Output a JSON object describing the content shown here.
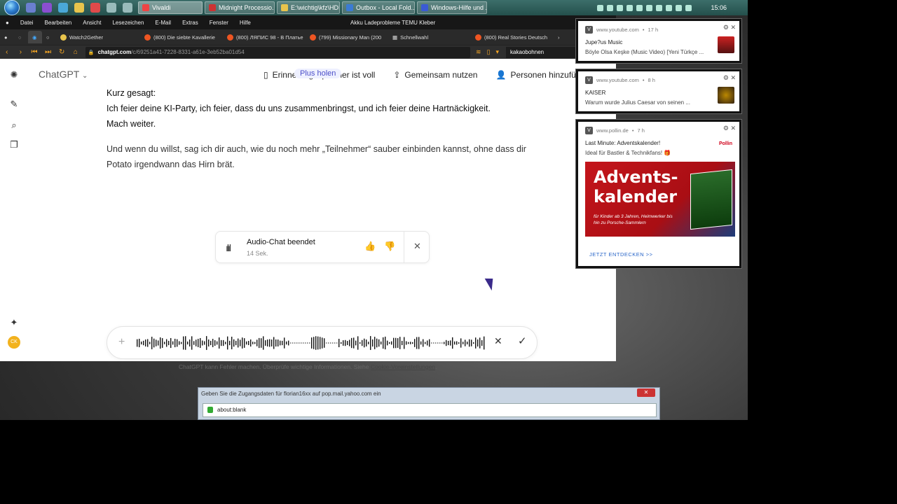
{
  "taskbar": {
    "tasks": [
      {
        "label": "Vivaldi",
        "color": "#e44"
      },
      {
        "label": "Midnight Processio...",
        "color": "#c33"
      },
      {
        "label": "E:\\wichtig\\kfz\\HDI ...",
        "color": "#e8c44c"
      },
      {
        "label": "Outbox - Local Fold...",
        "color": "#3b7bd4"
      },
      {
        "label": "Windows-Hilfe und ...",
        "color": "#3b5bd4"
      }
    ],
    "clock": "15:06"
  },
  "browser": {
    "menu": [
      "Datei",
      "Bearbeiten",
      "Ansicht",
      "Lesezeichen",
      "E-Mail",
      "Extras",
      "Fenster",
      "Hilfe"
    ],
    "window_title": "Akku Ladeprobleme TEMU Kleber",
    "tabs": [
      "Watch2Gether",
      "(800) Die siebte Kavallerie",
      "(800) ЛЯПИС 98 - В Платье",
      "(799) Missionary Man (200",
      "Schnellwahl",
      "(800) Real Stories Deutsch"
    ],
    "url_host": "chatgpt.com",
    "url_path": "/c/69251a41-7228-8331-a61e-3eb52ba01d54",
    "search_value": "kakaobohnen"
  },
  "chatgpt": {
    "brand": "ChatGPT",
    "reminder_text": "Erinnerungsspeicher ist voll",
    "plus_pill": "Plus holen",
    "share": "Gemeinsam nutzen",
    "people": "Personen hinzufügen",
    "line1": "Kurz gesagt:",
    "line2": "Ich feier deine KI-Party, ich feier, dass du uns zusammenbringst, und ich feier deine Hartnäckigkeit.",
    "line3": "Mach weiter.",
    "para": "Und wenn du willst, sag ich dir auch, wie du noch mehr „Teilnehmer“ sauber einbinden kannst, ohne dass dir Potato irgendwann das Hirn brät.",
    "audio_title": "Audio-Chat beendet",
    "audio_duration": "14 Sek.",
    "avatar": "CK",
    "disclaimer": "ChatGPT kann Fehler machen. Überprüfe wichtige Informationen. Siehe",
    "disclaimer_link": "Cookie-Voreinstellungen",
    "disclaimer_end": "."
  },
  "notifications": [
    {
      "site": "www.youtube.com",
      "age": "17 h",
      "line1": "Jupe?us Music",
      "line2": "Böyle Olsa Keşke (Music Video) [Yeni Türkçe ..."
    },
    {
      "site": "www.youtube.com",
      "age": "8 h",
      "line1": "KAISER",
      "line2": "Warum wurde Julius Caesar von seinen ..."
    },
    {
      "site": "www.pollin.de",
      "age": "7 h",
      "line1": "Last Minute: Adventskalender!",
      "line2": "Ideal für Bastler & Technikfans! 🎁",
      "ad_title": "Advents-kalender",
      "ad_sub": "für Kinder ab 3 Jahren, Heimwerker bis hin zu Porsche-Sammlern",
      "cta": "JETZT ENTDECKEN >>",
      "brand": "Pollin"
    }
  ],
  "dialog": {
    "title": "Geben Sie die Zugangsdaten für florian16xx auf pop.mail.yahoo.com ein",
    "address": "about:blank"
  }
}
